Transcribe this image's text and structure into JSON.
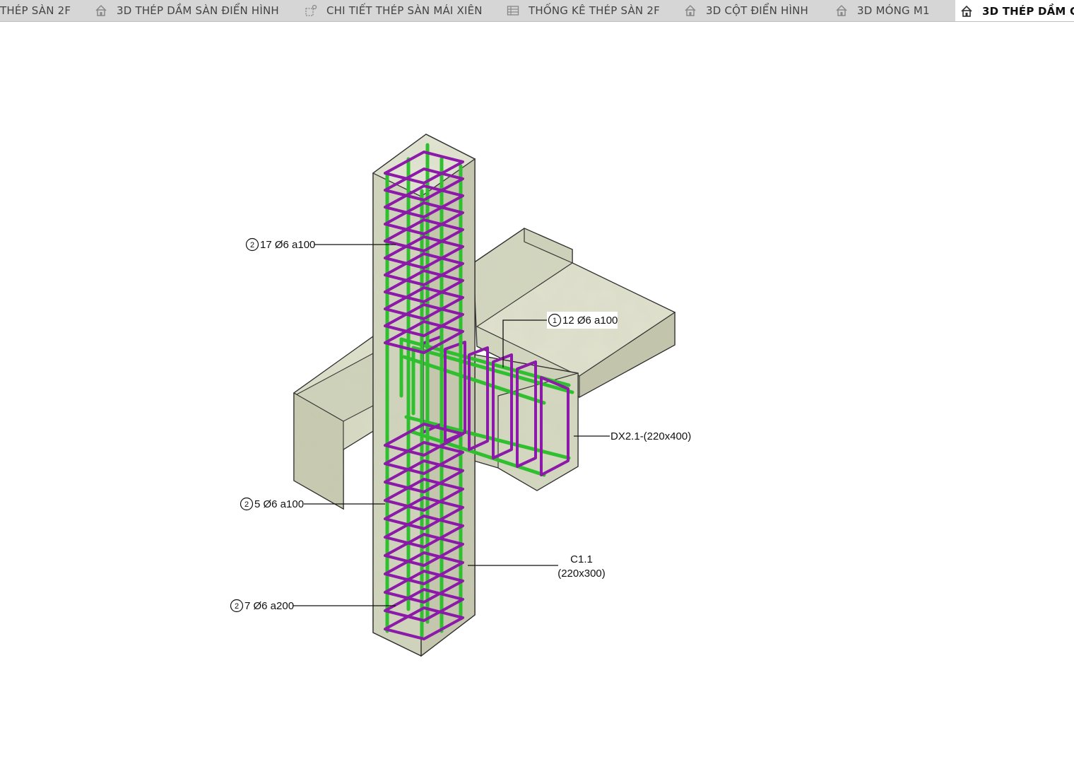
{
  "tabs": [
    {
      "label": "THÉP SÀN 2F",
      "icon": "none"
    },
    {
      "label": "3D THÉP DẦM SÀN ĐIỂN HÌNH",
      "icon": "house-3d-icon"
    },
    {
      "label": "CHI TIẾT THÉP SÀN MÁI XIÊN",
      "icon": "section-view-icon"
    },
    {
      "label": "THỐNG KÊ THÉP SÀN 2F",
      "icon": "schedule-table-icon"
    },
    {
      "label": "3D CỘT ĐIỂN HÌNH",
      "icon": "house-3d-icon"
    },
    {
      "label": "3D MÓNG M1",
      "icon": "house-3d-icon"
    },
    {
      "label": "3D THÉP DẦM C",
      "icon": "house-3d-icon",
      "active": true
    }
  ],
  "annotations": {
    "tag1": {
      "num": "2",
      "text": "17 Ø6 a100"
    },
    "tag2": {
      "num": "1",
      "text": "12 Ø6 a100"
    },
    "tag3": {
      "num": "2",
      "text": "5 Ø6 a100"
    },
    "tag4": {
      "num": "2",
      "text": "7 Ø6 a200"
    },
    "beam_label": "DX2.1-(220x400)",
    "column_label_line1": "C1.1",
    "column_label_line2": "(220x300)"
  },
  "colors": {
    "concrete_light": "#dcdfc9",
    "concrete_mid": "#c9ccb3",
    "concrete_dark": "#b5b89e",
    "stirrup": "#8c1aa8",
    "long_bar": "#2fbf2f",
    "tab_active_bg": "#ffffff",
    "tab_bar_bg": "#d6d6d6"
  }
}
